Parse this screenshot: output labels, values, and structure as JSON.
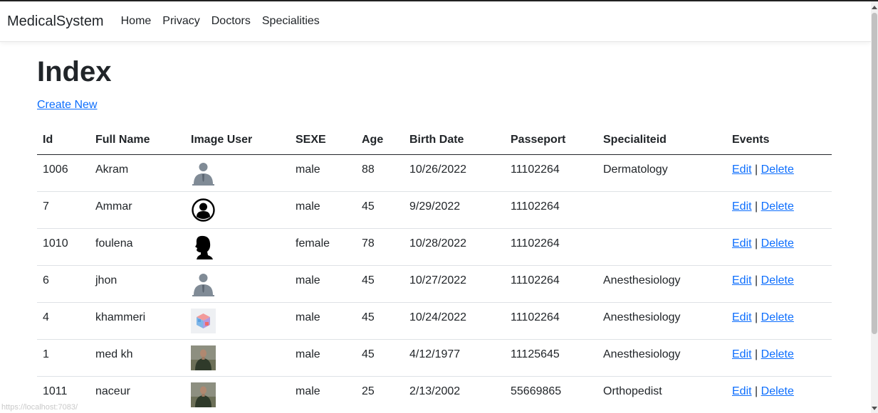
{
  "nav": {
    "brand": "MedicalSystem",
    "links": [
      "Home",
      "Privacy",
      "Doctors",
      "Specialities"
    ]
  },
  "page": {
    "title": "Index",
    "create_label": "Create New"
  },
  "table": {
    "headers": [
      "Id",
      "Full Name",
      "Image User",
      "SEXE",
      "Age",
      "Birth Date",
      "Passeport",
      "Specialiteid",
      "Events"
    ],
    "edit_label": "Edit",
    "separator": "|",
    "delete_label": "Delete",
    "rows": [
      {
        "id": "1006",
        "name": "Akram",
        "image": "person-silhouette-suit-icon",
        "sexe": "male",
        "age": "88",
        "birth": "10/26/2022",
        "passport": "11102264",
        "speciality": "Dermatology"
      },
      {
        "id": "7",
        "name": "Ammar",
        "image": "user-circle-icon",
        "sexe": "male",
        "age": "45",
        "birth": "9/29/2022",
        "passport": "11102264",
        "speciality": ""
      },
      {
        "id": "1010",
        "name": "foulena",
        "image": "head-silhouette-icon",
        "sexe": "female",
        "age": "78",
        "birth": "10/28/2022",
        "passport": "11102264",
        "speciality": ""
      },
      {
        "id": "6",
        "name": "jhon",
        "image": "person-silhouette-suit-icon",
        "sexe": "male",
        "age": "45",
        "birth": "10/27/2022",
        "passport": "11102264",
        "speciality": "Anesthesiology"
      },
      {
        "id": "4",
        "name": "khammeri",
        "image": "colorful-cube-image",
        "sexe": "male",
        "age": "45",
        "birth": "10/24/2022",
        "passport": "11102264",
        "speciality": "Anesthesiology"
      },
      {
        "id": "1",
        "name": "med kh",
        "image": "person-photo",
        "sexe": "male",
        "age": "45",
        "birth": "4/12/1977",
        "passport": "11125645",
        "speciality": "Anesthesiology"
      },
      {
        "id": "1011",
        "name": "naceur",
        "image": "person-photo",
        "sexe": "male",
        "age": "25",
        "birth": "2/13/2002",
        "passport": "55669865",
        "speciality": "Orthopedist"
      }
    ]
  },
  "status_url": "https://localhost:7083/"
}
